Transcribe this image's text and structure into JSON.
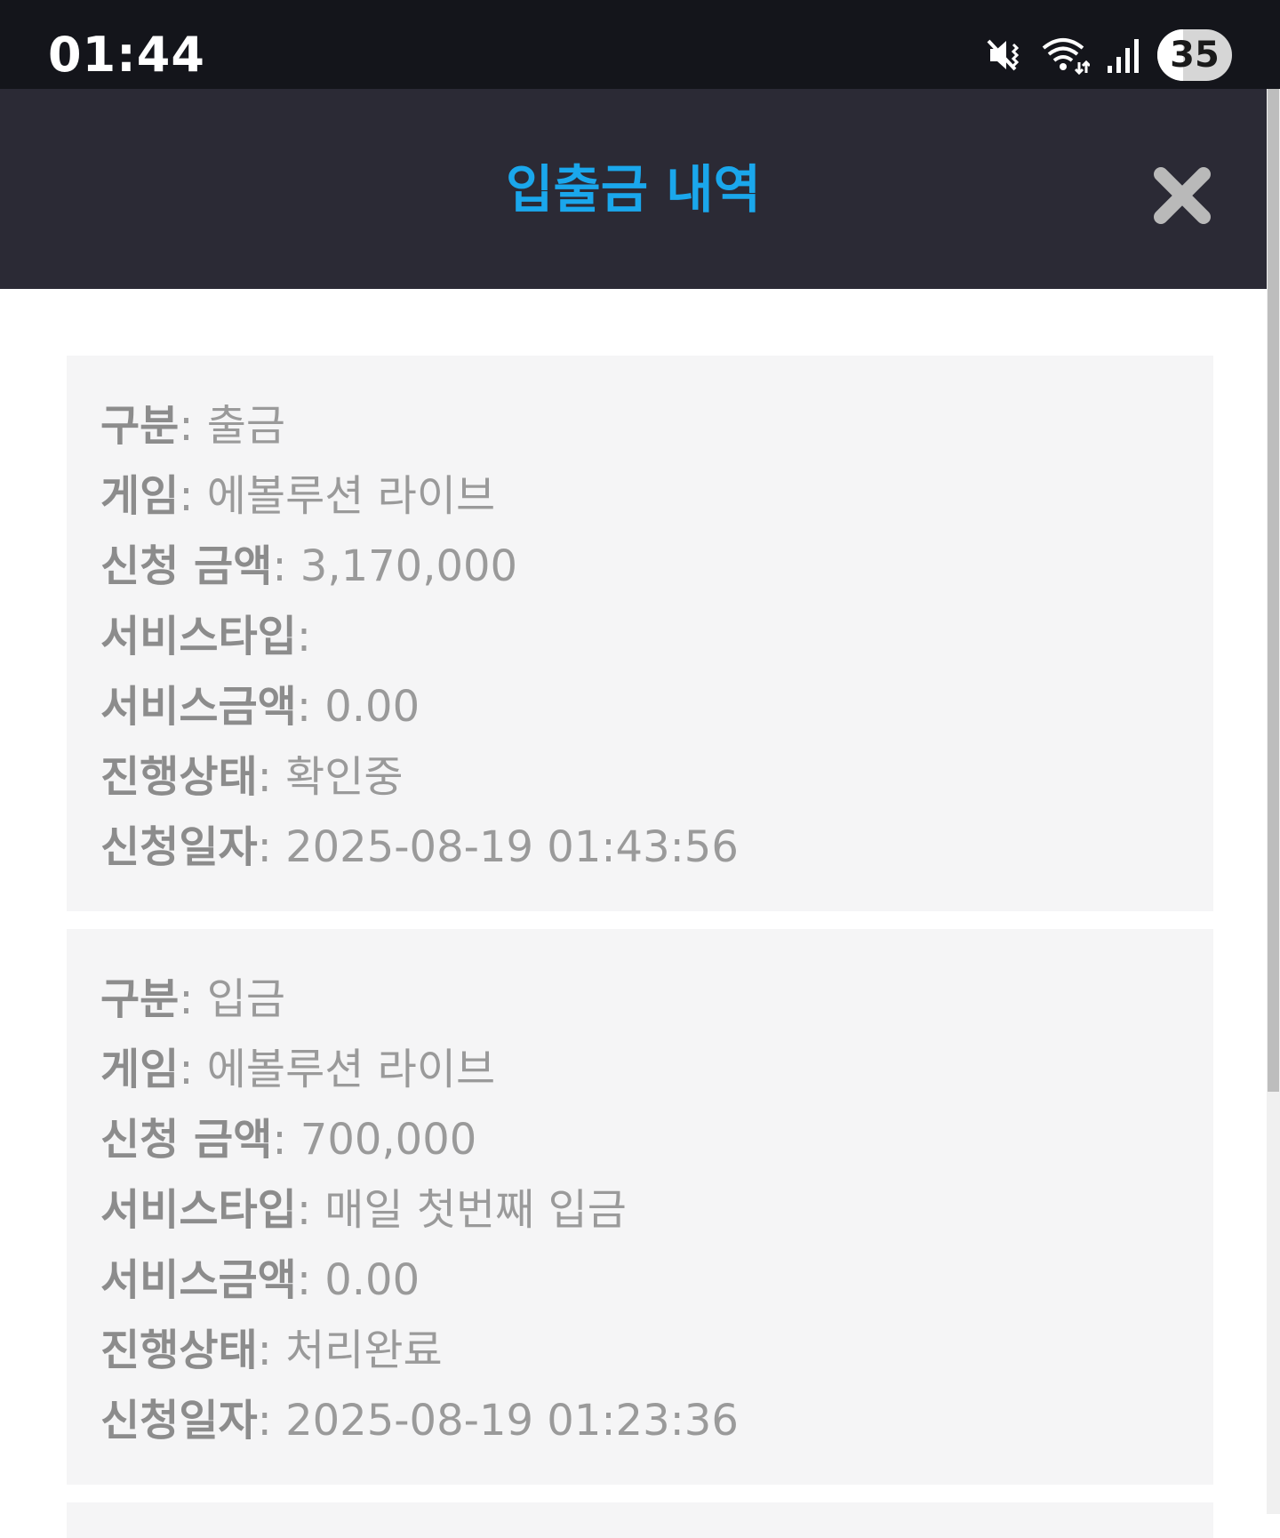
{
  "status_bar": {
    "time": "01:44",
    "battery_level": "35",
    "icons": [
      "mute-vibrate-icon",
      "wifi-icon",
      "signal-icon",
      "battery-icon"
    ]
  },
  "header": {
    "title": "입출금 내역",
    "close_icon": "close-icon",
    "title_color": "#1aa7ec",
    "background": "#2b2a35"
  },
  "records": [
    {
      "type_label": "구분",
      "type_value": "출금",
      "game_label": "게임",
      "game_value": "에볼루션 라이브",
      "amount_label": "신청 금액",
      "amount_value": "3,170,000",
      "service_type_label": "서비스타입",
      "service_type_value": "",
      "service_amount_label": "서비스금액",
      "service_amount_value": "0.00",
      "status_label": "진행상태",
      "status_value": "확인중",
      "date_label": "신청일자",
      "date_value": "2025-08-19 01:43:56"
    },
    {
      "type_label": "구분",
      "type_value": "입금",
      "game_label": "게임",
      "game_value": "에볼루션 라이브",
      "amount_label": "신청 금액",
      "amount_value": "700,000",
      "service_type_label": "서비스타입",
      "service_type_value": "매일 첫번째 입금",
      "service_amount_label": "서비스금액",
      "service_amount_value": "0.00",
      "status_label": "진행상태",
      "status_value": "처리완료",
      "date_label": "신청일자",
      "date_value": "2025-08-19 01:23:36"
    }
  ]
}
